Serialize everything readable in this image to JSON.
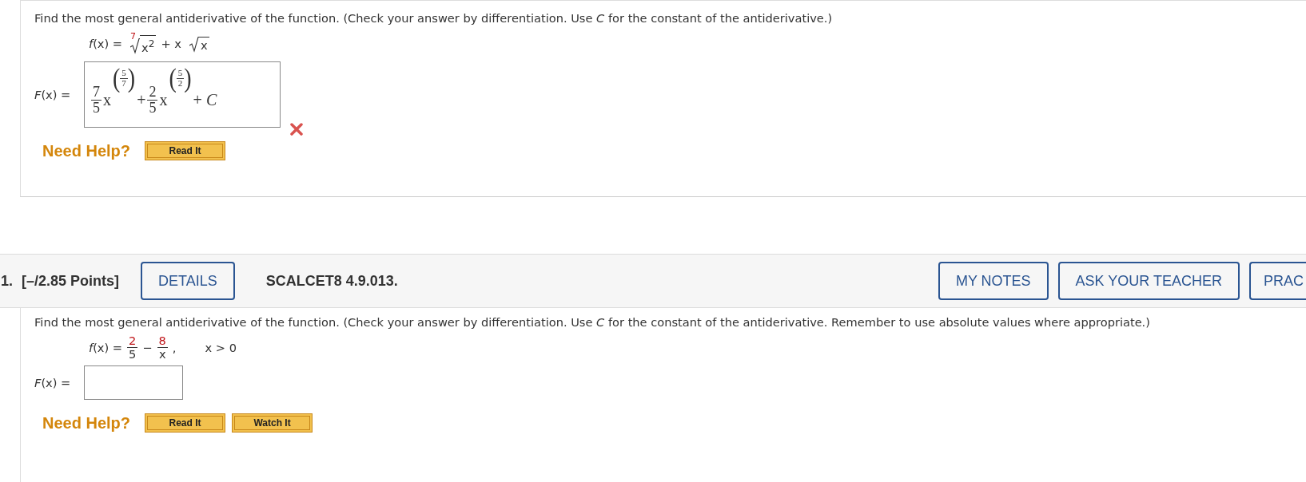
{
  "questions": [
    {
      "prompt": "Find the most general antiderivative of the function. (Check your answer by differentiation. Use *C* for the constant of the antiderivative.)",
      "function": [
        {
          "kind": "text",
          "text": "*f*(x) ="
        },
        {
          "kind": "root",
          "index": "7",
          "highlighted": true,
          "radicand": "x$^{2}$"
        },
        {
          "kind": "text",
          "text": "+ x"
        },
        {
          "kind": "root",
          "radicand": "x"
        }
      ],
      "answer_label": "*F*(x) =",
      "answer": [
        {
          "kind": "frac",
          "num": "7",
          "den": "5"
        },
        {
          "kind": "text",
          "text": "x"
        },
        {
          "kind": "powfrac",
          "open": "(",
          "num": "5",
          "den": "7",
          "close": ")"
        },
        {
          "kind": "op",
          "text": "+"
        },
        {
          "kind": "frac",
          "num": "2",
          "den": "5"
        },
        {
          "kind": "text",
          "text": "x"
        },
        {
          "kind": "powfrac",
          "open": "(",
          "num": "5",
          "den": "2",
          "close": ")"
        },
        {
          "kind": "op",
          "text": "+ *C*"
        }
      ],
      "correct": false,
      "help_label": "Need Help?",
      "help_buttons": [
        "Read It"
      ]
    },
    {
      "header": {
        "number": "1.",
        "points": "[–/2.85 Points]",
        "details": "DETAILS",
        "code": "SCALCET8 4.9.013.",
        "actions": [
          "MY NOTES",
          "ASK YOUR TEACHER",
          "PRAC"
        ]
      },
      "prompt": "Find the most general antiderivative of the function. (Check your answer by differentiation. Use *C* for the constant of the antiderivative. Remember to use absolute values where appropriate.)",
      "function": [
        {
          "kind": "text",
          "text": "*f*(x) ="
        },
        {
          "kind": "frac",
          "num": "2",
          "den": "5",
          "highlighted": true
        },
        {
          "kind": "text",
          "text": "−"
        },
        {
          "kind": "frac",
          "num": "8",
          "den": "x",
          "highlighted": true
        },
        {
          "kind": "text",
          "text": ","
        },
        {
          "kind": "cond",
          "text": "x > 0"
        }
      ],
      "answer_label": "*F*(x) =",
      "help_label": "Need Help?",
      "help_buttons": [
        "Read It",
        "Watch It"
      ]
    }
  ]
}
